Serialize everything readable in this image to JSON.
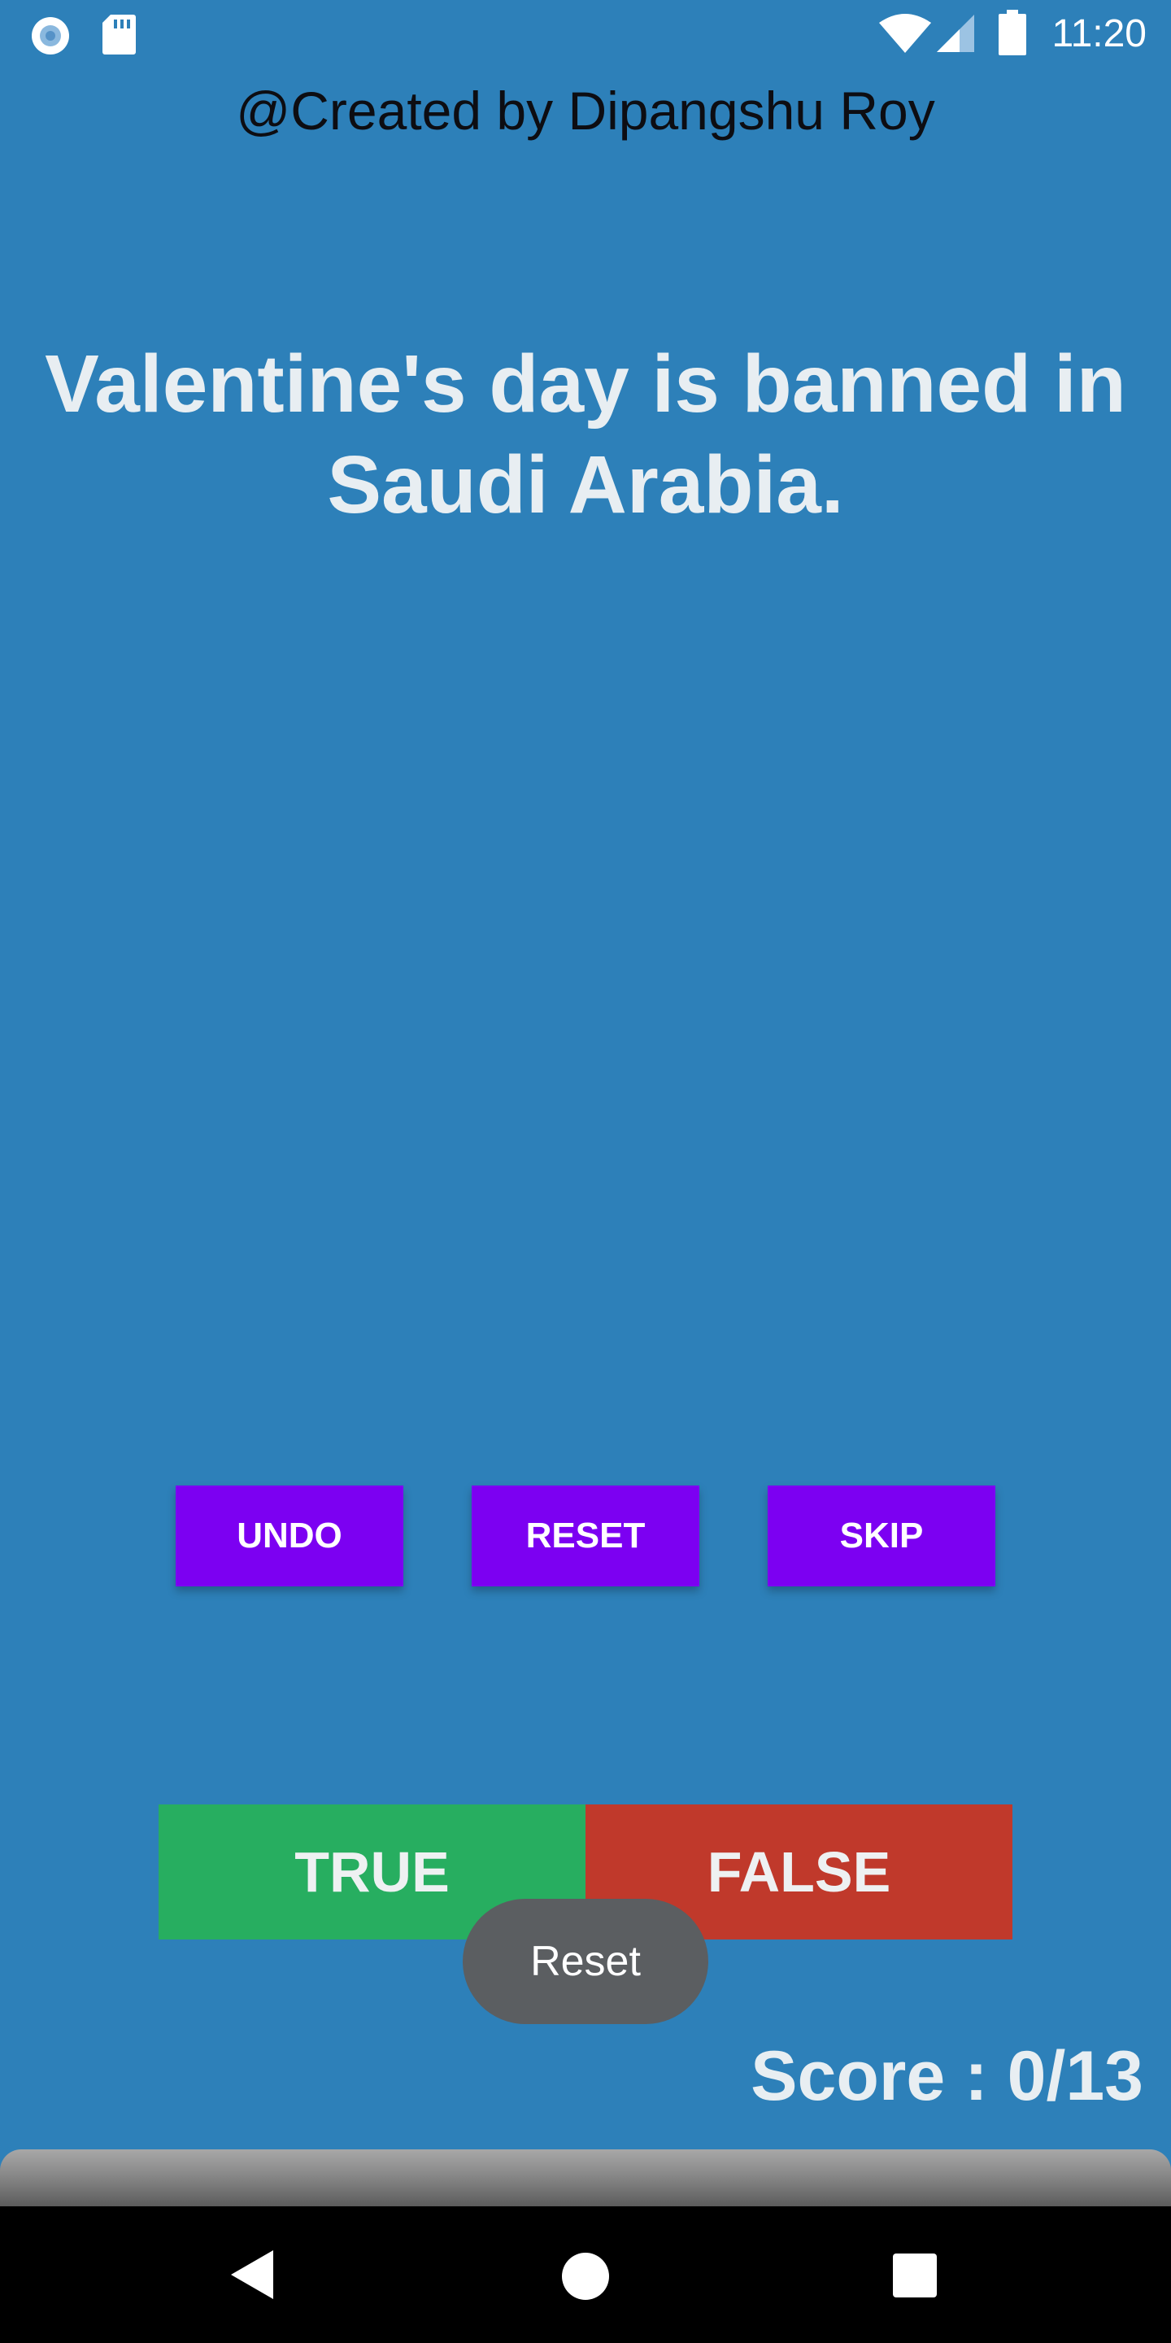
{
  "status_bar": {
    "time": "11:20",
    "left_icons": [
      "record-icon",
      "sd-card-icon"
    ],
    "right_icons": [
      "wifi-icon",
      "cellular-signal-icon",
      "battery-icon"
    ]
  },
  "credit": "@Created by Dipangshu Roy",
  "question": "Valentine's day is banned in Saudi Arabia.",
  "controls": {
    "undo_label": "UNDO",
    "reset_label": "RESET",
    "skip_label": "SKIP"
  },
  "answers": {
    "true_label": "TRUE",
    "false_label": "FALSE"
  },
  "toast": "Reset",
  "score": "Score : 0/13",
  "nav": [
    "back-icon",
    "home-icon",
    "recents-icon"
  ],
  "colors": {
    "background": "#2d80b9",
    "action_button": "#7c00f2",
    "true_button": "#27ae60",
    "false_button": "#c0392b",
    "toast": "#5b5e61"
  }
}
